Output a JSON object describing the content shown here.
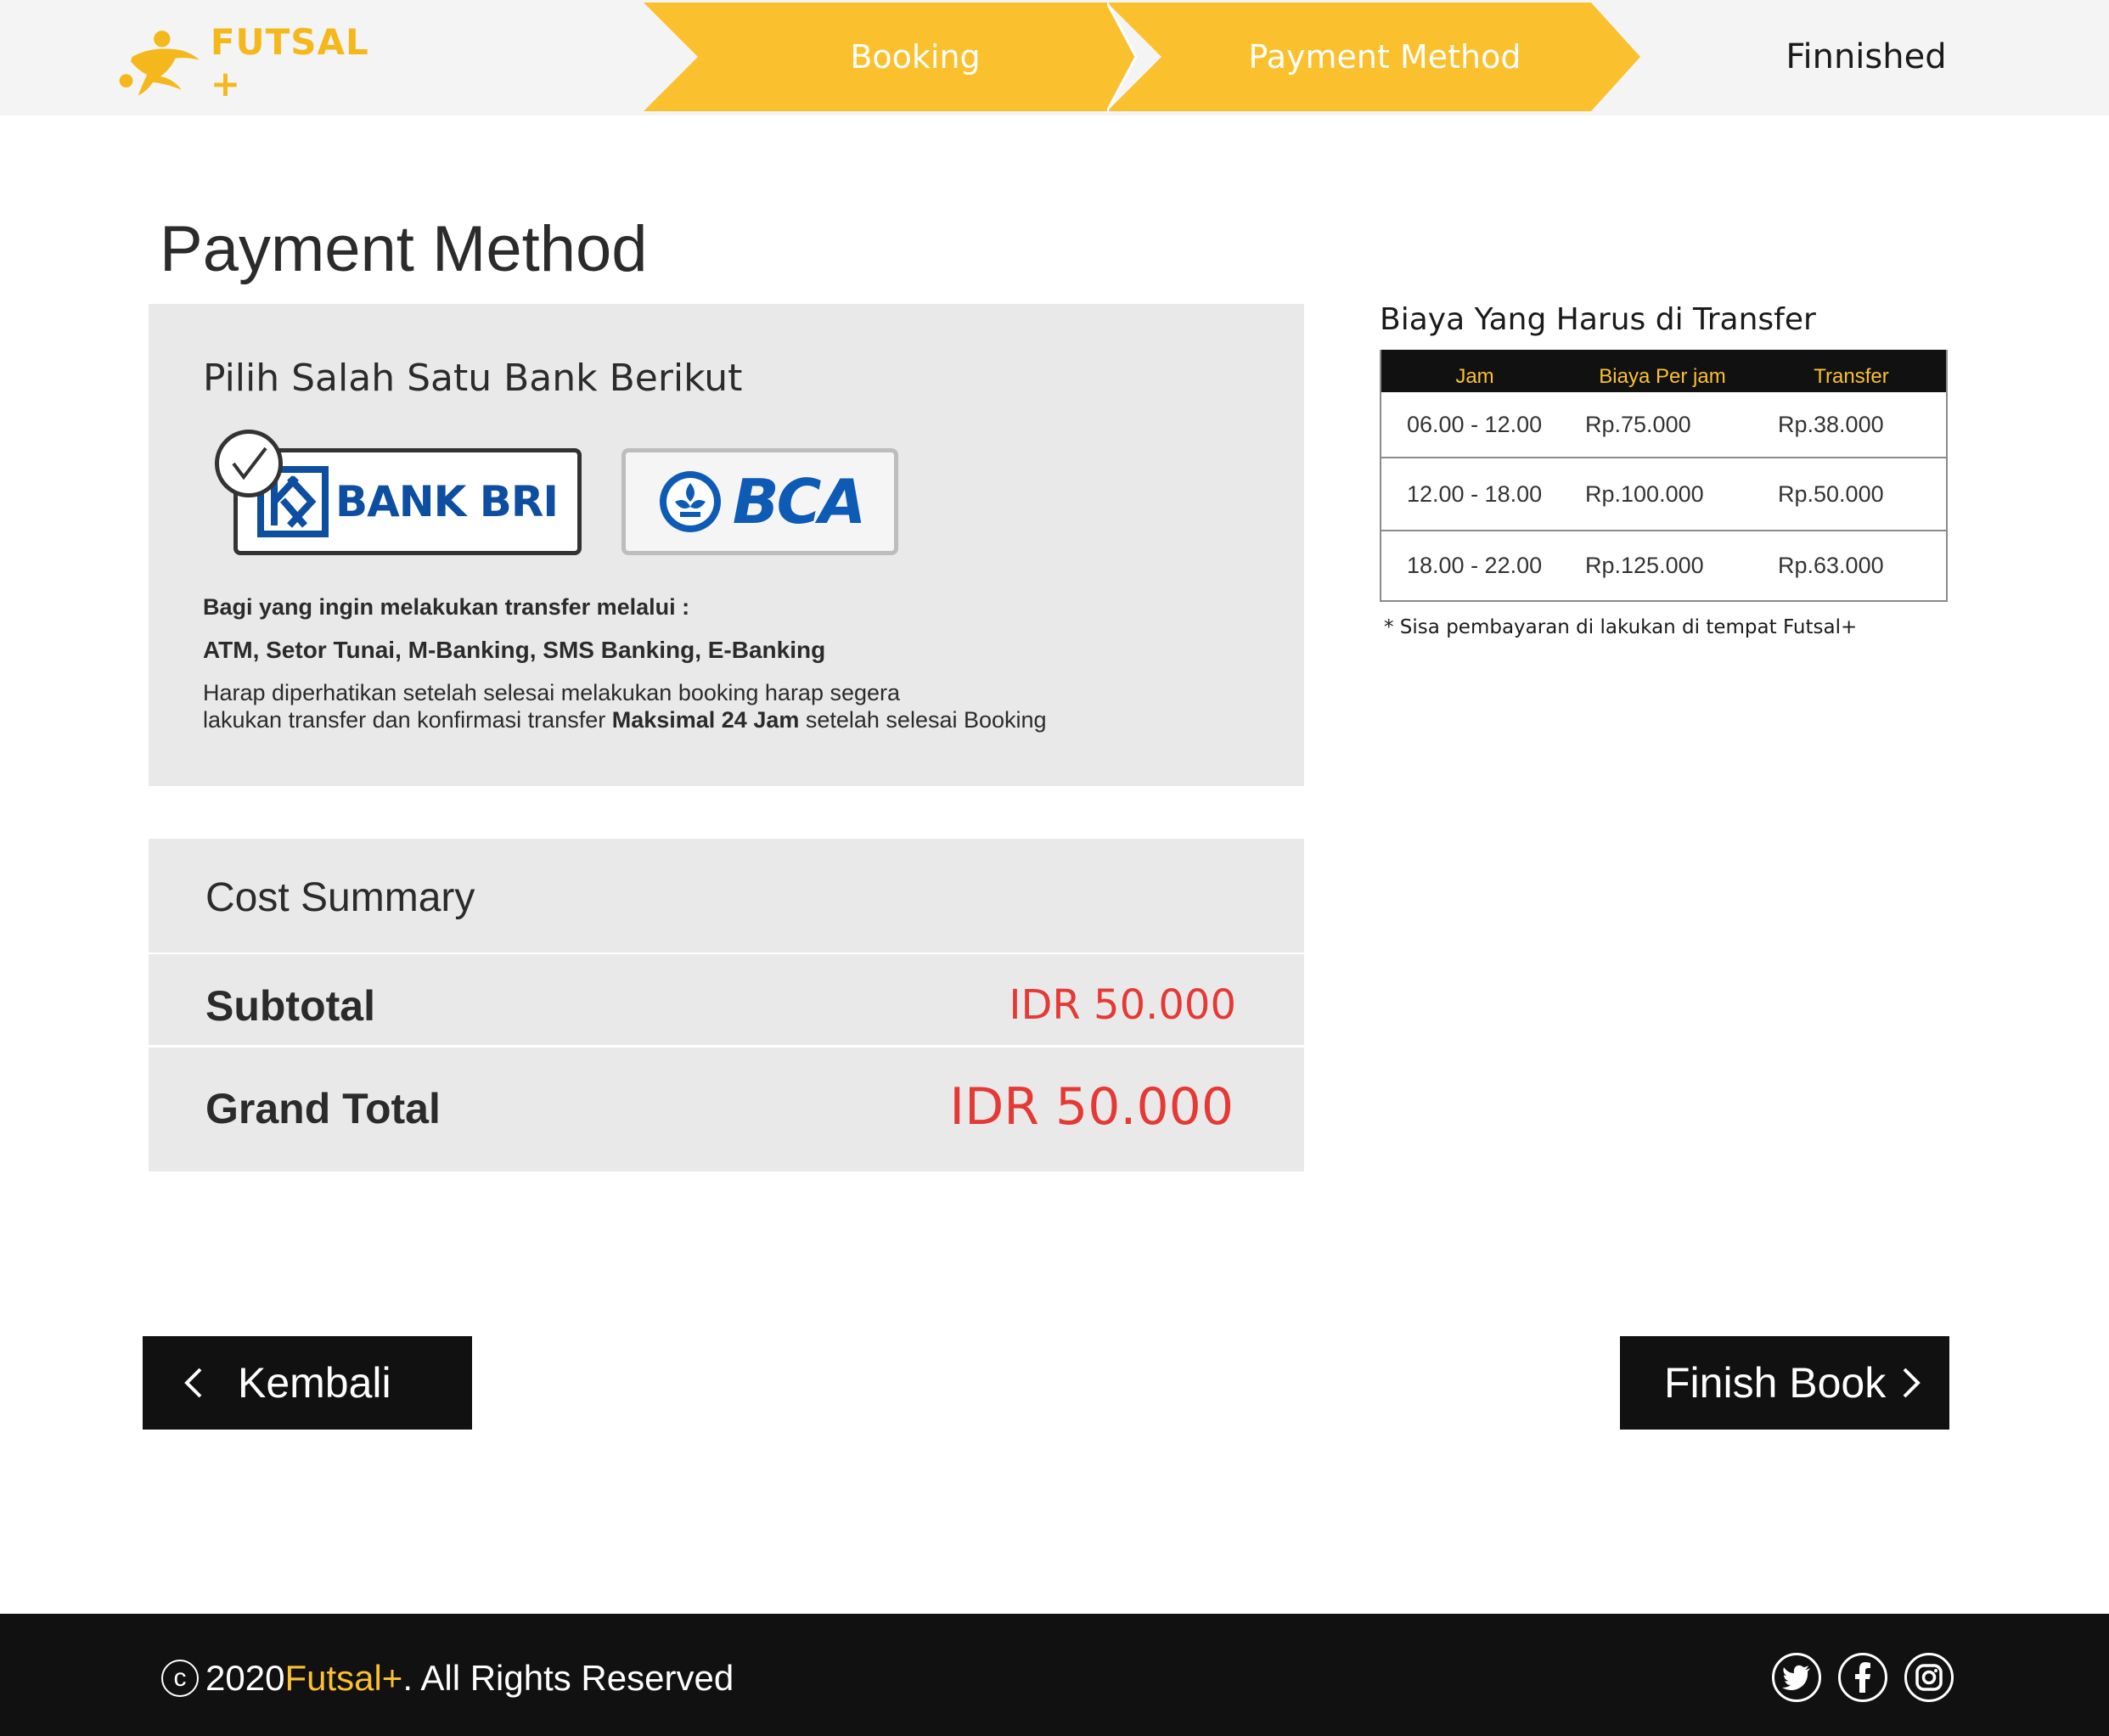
{
  "header": {
    "logo_text": "FUTSAL +",
    "steps": {
      "booking": "Booking",
      "payment": "Payment Method",
      "finished": "Finnished"
    }
  },
  "page_title": "Payment Method",
  "bank_section": {
    "heading": "Pilih Salah Satu Bank Berikut",
    "banks": {
      "bri": {
        "label": "BANK BRI",
        "selected": true
      },
      "bca": {
        "label": "BCA",
        "selected": false
      }
    },
    "info_line1": "Bagi yang ingin melakukan transfer melalui :",
    "info_line2": "ATM, Setor Tunai, M-Banking, SMS Banking, E-Banking",
    "notice_line1": "Harap diperhatikan setelah selesai melakukan booking harap segera",
    "notice_prefix": "lakukan transfer dan konfirmasi transfer ",
    "notice_bold": "Maksimal 24 Jam",
    "notice_suffix": " setelah selesai Booking"
  },
  "cost_summary": {
    "title": "Cost Summary",
    "subtotal_label": "Subtotal",
    "subtotal_value": "IDR 50.000",
    "grand_total_label": "Grand Total",
    "grand_total_value": "IDR 50.000"
  },
  "transfer": {
    "title": "Biaya Yang Harus di Transfer",
    "columns": [
      "Jam",
      "Biaya Per jam",
      "Transfer"
    ],
    "rows": [
      [
        "06.00 - 12.00",
        "Rp.75.000",
        "Rp.38.000"
      ],
      [
        "12.00 - 18.00",
        "Rp.100.000",
        "Rp.50.000"
      ],
      [
        "18.00 - 22.00",
        "Rp.125.000",
        "Rp.63.000"
      ]
    ],
    "note": "* Sisa pembayaran di lakukan di tempat Futsal+"
  },
  "buttons": {
    "back": "Kembali",
    "finish": "Finish Book"
  },
  "footer": {
    "copy_symbol": "c",
    "year": " 2020 ",
    "brand": "Futsal+",
    "rights": ". All Rights Reserved"
  },
  "colors": {
    "accent": "#fbc02d",
    "price_red": "#e53935",
    "dark": "#111111",
    "panel": "#e9e9e9"
  },
  "icons": [
    "futsal-logo-icon",
    "check-icon",
    "bri-logo-icon",
    "bca-logo-icon",
    "chevron-left-icon",
    "chevron-right-icon",
    "twitter-icon",
    "facebook-icon",
    "instagram-icon"
  ]
}
